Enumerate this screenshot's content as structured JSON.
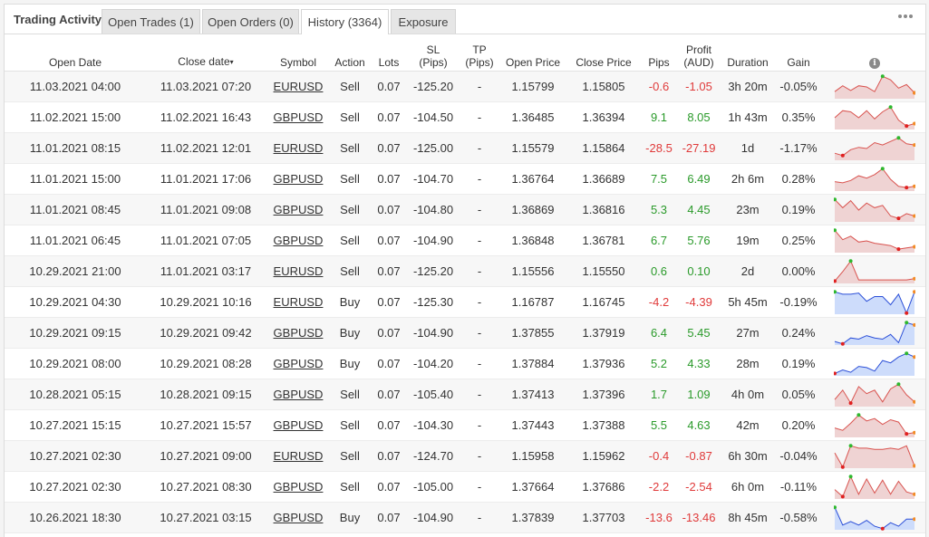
{
  "tabs": {
    "title": "Trading Activity",
    "items": [
      {
        "label": "Open Trades (1)"
      },
      {
        "label": "Open Orders (0)"
      },
      {
        "label": "History (3364)"
      },
      {
        "label": "Exposure"
      }
    ],
    "active": 2
  },
  "headers": {
    "open_date": "Open Date",
    "close_date": "Close date",
    "sort_arrow": "▾",
    "symbol": "Symbol",
    "action": "Action",
    "lots": "Lots",
    "sl_1": "SL",
    "sl_2": "(Pips)",
    "tp_1": "TP",
    "tp_2": "(Pips)",
    "open_price": "Open Price",
    "close_price": "Close Price",
    "pips": "Pips",
    "profit_1": "Profit",
    "profit_2": "(AUD)",
    "duration": "Duration",
    "gain": "Gain",
    "info": "i"
  },
  "colors": {
    "positive": "#2a9a2a",
    "negative": "#e03a3a",
    "sell_fill": "#efd3d3",
    "sell_line": "#d9534f",
    "buy_fill": "#cddcfb",
    "buy_line": "#2b4fd8",
    "marker_high": "#2eb82e",
    "marker_low": "#e02020",
    "marker_end": "#f28c28"
  },
  "rows": [
    {
      "open_date": "11.03.2021 04:00",
      "close_date": "11.03.2021 07:20",
      "symbol": "EURUSD",
      "action": "Sell",
      "lots": "0.07",
      "sl": "-125.20",
      "tp": "-",
      "open_price": "1.15799",
      "close_price": "1.15805",
      "pips": "-0.6",
      "profit": "-1.05",
      "duration": "3h 20m",
      "gain": "-0.05%",
      "spark": [
        0.3,
        0.55,
        0.35,
        0.55,
        0.5,
        0.3,
        0.95,
        0.8,
        0.45,
        0.6,
        0.25
      ]
    },
    {
      "open_date": "11.02.2021 15:00",
      "close_date": "11.02.2021 16:43",
      "symbol": "GBPUSD",
      "action": "Sell",
      "lots": "0.07",
      "sl": "-104.50",
      "tp": "-",
      "open_price": "1.36485",
      "close_price": "1.36394",
      "pips": "9.1",
      "profit": "8.05",
      "duration": "1h 43m",
      "gain": "0.35%",
      "spark": [
        0.5,
        0.8,
        0.75,
        0.5,
        0.8,
        0.45,
        0.75,
        0.95,
        0.4,
        0.15,
        0.25
      ]
    },
    {
      "open_date": "11.01.2021 08:15",
      "close_date": "11.02.2021 12:01",
      "symbol": "EURUSD",
      "action": "Sell",
      "lots": "0.07",
      "sl": "-125.00",
      "tp": "-",
      "open_price": "1.15579",
      "close_price": "1.15864",
      "pips": "-28.5",
      "profit": "-27.19",
      "duration": "1d",
      "gain": "-1.17%",
      "spark": [
        0.3,
        0.2,
        0.45,
        0.55,
        0.5,
        0.75,
        0.65,
        0.8,
        0.95,
        0.7,
        0.65
      ]
    },
    {
      "open_date": "11.01.2021 15:00",
      "close_date": "11.01.2021 17:06",
      "symbol": "GBPUSD",
      "action": "Sell",
      "lots": "0.07",
      "sl": "-104.70",
      "tp": "-",
      "open_price": "1.36764",
      "close_price": "1.36689",
      "pips": "7.5",
      "profit": "6.49",
      "duration": "2h 6m",
      "gain": "0.28%",
      "spark": [
        0.4,
        0.35,
        0.45,
        0.65,
        0.55,
        0.7,
        0.95,
        0.5,
        0.2,
        0.15,
        0.2
      ]
    },
    {
      "open_date": "11.01.2021 08:45",
      "close_date": "11.01.2021 09:08",
      "symbol": "GBPUSD",
      "action": "Sell",
      "lots": "0.07",
      "sl": "-104.80",
      "tp": "-",
      "open_price": "1.36869",
      "close_price": "1.36816",
      "pips": "5.3",
      "profit": "4.45",
      "duration": "23m",
      "gain": "0.19%",
      "spark": [
        0.95,
        0.6,
        0.9,
        0.5,
        0.8,
        0.6,
        0.7,
        0.25,
        0.15,
        0.35,
        0.25
      ]
    },
    {
      "open_date": "11.01.2021 06:45",
      "close_date": "11.01.2021 07:05",
      "symbol": "GBPUSD",
      "action": "Sell",
      "lots": "0.07",
      "sl": "-104.90",
      "tp": "-",
      "open_price": "1.36848",
      "close_price": "1.36781",
      "pips": "6.7",
      "profit": "5.76",
      "duration": "19m",
      "gain": "0.25%",
      "spark": [
        0.95,
        0.55,
        0.7,
        0.45,
        0.5,
        0.4,
        0.35,
        0.3,
        0.15,
        0.2,
        0.25
      ]
    },
    {
      "open_date": "10.29.2021 21:00",
      "close_date": "11.01.2021 03:17",
      "symbol": "EURUSD",
      "action": "Sell",
      "lots": "0.07",
      "sl": "-125.20",
      "tp": "-",
      "open_price": "1.15556",
      "close_price": "1.15550",
      "pips": "0.6",
      "profit": "0.10",
      "duration": "2d",
      "gain": "0.00%",
      "spark": [
        0.1,
        0.5,
        0.95,
        0.15,
        0.15,
        0.15,
        0.15,
        0.15,
        0.15,
        0.15,
        0.2
      ]
    },
    {
      "open_date": "10.29.2021 04:30",
      "close_date": "10.29.2021 10:16",
      "symbol": "EURUSD",
      "action": "Buy",
      "lots": "0.07",
      "sl": "-125.30",
      "tp": "-",
      "open_price": "1.16787",
      "close_price": "1.16745",
      "pips": "-4.2",
      "profit": "-4.39",
      "duration": "5h 45m",
      "gain": "-0.19%",
      "spark": [
        0.95,
        0.85,
        0.85,
        0.9,
        0.55,
        0.75,
        0.75,
        0.4,
        0.85,
        0.05,
        0.95
      ]
    },
    {
      "open_date": "10.29.2021 09:15",
      "close_date": "10.29.2021 09:42",
      "symbol": "GBPUSD",
      "action": "Buy",
      "lots": "0.07",
      "sl": "-104.90",
      "tp": "-",
      "open_price": "1.37855",
      "close_price": "1.37919",
      "pips": "6.4",
      "profit": "5.45",
      "duration": "27m",
      "gain": "0.24%",
      "spark": [
        0.15,
        0.05,
        0.3,
        0.25,
        0.4,
        0.3,
        0.25,
        0.45,
        0.1,
        0.95,
        0.85
      ]
    },
    {
      "open_date": "10.29.2021 08:00",
      "close_date": "10.29.2021 08:28",
      "symbol": "GBPUSD",
      "action": "Buy",
      "lots": "0.07",
      "sl": "-104.20",
      "tp": "-",
      "open_price": "1.37884",
      "close_price": "1.37936",
      "pips": "5.2",
      "profit": "4.33",
      "duration": "28m",
      "gain": "0.19%",
      "spark": [
        0.1,
        0.25,
        0.15,
        0.4,
        0.35,
        0.2,
        0.65,
        0.55,
        0.8,
        0.95,
        0.8
      ]
    },
    {
      "open_date": "10.28.2021 05:15",
      "close_date": "10.28.2021 09:15",
      "symbol": "GBPUSD",
      "action": "Sell",
      "lots": "0.07",
      "sl": "-105.40",
      "tp": "-",
      "open_price": "1.37413",
      "close_price": "1.37396",
      "pips": "1.7",
      "profit": "1.09",
      "duration": "4h 0m",
      "gain": "0.05%",
      "spark": [
        0.3,
        0.7,
        0.15,
        0.85,
        0.55,
        0.7,
        0.2,
        0.75,
        0.95,
        0.5,
        0.2
      ]
    },
    {
      "open_date": "10.27.2021 15:15",
      "close_date": "10.27.2021 15:57",
      "symbol": "GBPUSD",
      "action": "Sell",
      "lots": "0.07",
      "sl": "-104.30",
      "tp": "-",
      "open_price": "1.37443",
      "close_price": "1.37388",
      "pips": "5.5",
      "profit": "4.63",
      "duration": "42m",
      "gain": "0.20%",
      "spark": [
        0.4,
        0.3,
        0.6,
        0.95,
        0.7,
        0.8,
        0.55,
        0.75,
        0.65,
        0.15,
        0.2
      ]
    },
    {
      "open_date": "10.27.2021 02:30",
      "close_date": "10.27.2021 09:00",
      "symbol": "EURUSD",
      "action": "Sell",
      "lots": "0.07",
      "sl": "-124.70",
      "tp": "-",
      "open_price": "1.15958",
      "close_price": "1.15962",
      "pips": "-0.4",
      "profit": "-0.87",
      "duration": "6h 30m",
      "gain": "-0.04%",
      "spark": [
        0.65,
        0.05,
        0.95,
        0.85,
        0.85,
        0.8,
        0.8,
        0.85,
        0.8,
        0.95,
        0.1
      ]
    },
    {
      "open_date": "10.27.2021 02:30",
      "close_date": "10.27.2021 08:30",
      "symbol": "GBPUSD",
      "action": "Sell",
      "lots": "0.07",
      "sl": "-105.00",
      "tp": "-",
      "open_price": "1.37664",
      "close_price": "1.37686",
      "pips": "-2.2",
      "profit": "-2.54",
      "duration": "6h 0m",
      "gain": "-0.11%",
      "spark": [
        0.4,
        0.1,
        0.95,
        0.2,
        0.85,
        0.25,
        0.8,
        0.2,
        0.75,
        0.3,
        0.2
      ]
    },
    {
      "open_date": "10.26.2021 18:30",
      "close_date": "10.27.2021 03:15",
      "symbol": "GBPUSD",
      "action": "Buy",
      "lots": "0.07",
      "sl": "-104.90",
      "tp": "-",
      "open_price": "1.37839",
      "close_price": "1.37703",
      "pips": "-13.6",
      "profit": "-13.46",
      "duration": "8h 45m",
      "gain": "-0.58%",
      "spark": [
        0.95,
        0.2,
        0.35,
        0.2,
        0.4,
        0.15,
        0.05,
        0.3,
        0.15,
        0.45,
        0.45
      ]
    }
  ]
}
